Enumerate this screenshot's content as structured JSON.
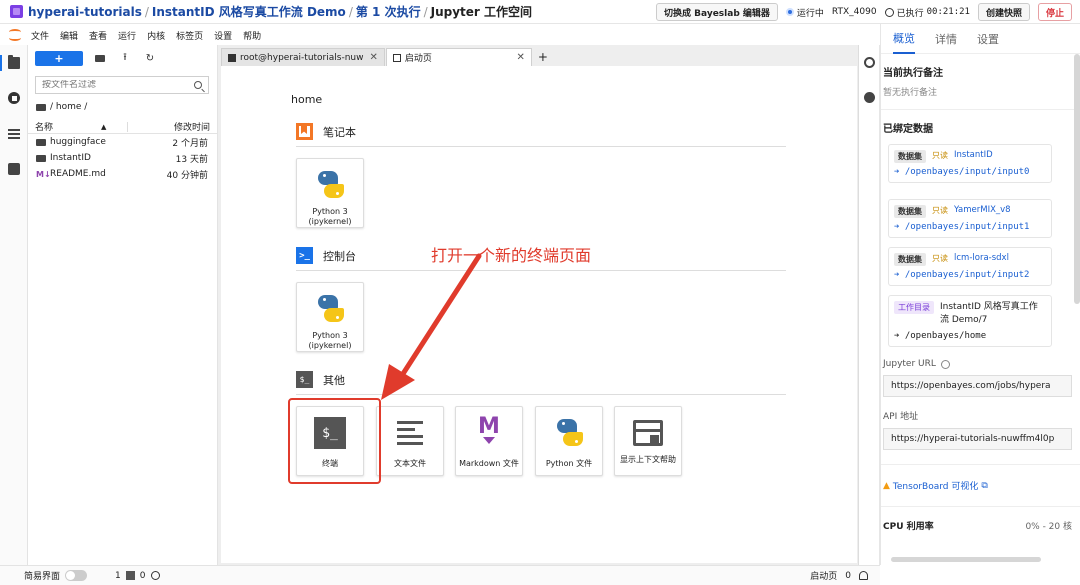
{
  "topbar": {
    "breadcrumb": [
      "hyperai-tutorials",
      "InstantID 风格写真工作流 Demo",
      "第 1 次执行",
      "Jupyter 工作空间"
    ],
    "switch_button": "切换成 Bayeslab 编辑器",
    "status": "运行中",
    "gpu": "RTX_4090",
    "elapsed_prefix": "已执行",
    "elapsed": "00:21:21",
    "snapshot_button": "创建快照",
    "stop_button": "停止",
    "colors": {
      "stop": "#d9363e",
      "running": "#2f6fe0",
      "brand": "#7b3fe4"
    }
  },
  "menu": [
    "文件",
    "编辑",
    "查看",
    "运行",
    "内核",
    "标签页",
    "设置",
    "帮助"
  ],
  "activity_icons": [
    "folder-icon",
    "running-icon",
    "toc-icon",
    "extension-icon"
  ],
  "filebrowser": {
    "new_label": "+",
    "search_placeholder": "按文件名过滤",
    "path": "/ home /",
    "col_name": "名称",
    "col_time": "修改时间",
    "items": [
      {
        "name": "huggingface",
        "time": "2 个月前",
        "icon": "folder-icon"
      },
      {
        "name": "InstantID",
        "time": "13 天前",
        "icon": "folder-icon"
      },
      {
        "name": "README.md",
        "time": "40 分钟前",
        "icon": "markdown-icon"
      }
    ]
  },
  "tabs": [
    {
      "label": "root@hyperai-tutorials-nuw",
      "icon": "terminal-icon"
    },
    {
      "label": "启动页",
      "icon": "launcher-icon"
    }
  ],
  "tab_add": "+",
  "launcher": {
    "path": "home",
    "notebook_section": "笔记本",
    "console_section": "控制台",
    "other_section": "其他",
    "console_glyph": ">_",
    "other_glyph": "$_",
    "notebook_cards": [
      {
        "label": "Python 3 (ipykernel)"
      }
    ],
    "console_cards": [
      {
        "label": "Python 3 (ipykernel)"
      }
    ],
    "other_cards": [
      {
        "label": "终端",
        "glyph": "$_"
      },
      {
        "label": "文本文件"
      },
      {
        "label": "Markdown 文件",
        "glyph": "M"
      },
      {
        "label": "Python 文件"
      },
      {
        "label": "显示上下文帮助"
      }
    ]
  },
  "annotation": {
    "text": "打开一个新的终端页面",
    "color": "#e03b2c"
  },
  "right_panel": {
    "tabs": [
      "概览",
      "详情",
      "设置"
    ],
    "notes_title": "当前执行备注",
    "notes_empty": "暂无执行备注",
    "bound_title": "已绑定数据",
    "datasets": [
      {
        "badge": "数据集",
        "access": "只读",
        "name": "InstantID",
        "path": "/openbayes/input/input0"
      },
      {
        "badge": "数据集",
        "access": "只读",
        "name": "YamerMIX_v8",
        "path": "/openbayes/input/input1"
      },
      {
        "badge": "数据集",
        "access": "只读",
        "name": "lcm-lora-sdxl",
        "path": "/openbayes/input/input2"
      }
    ],
    "workdir": {
      "badge": "工作目录",
      "name": "InstantID 风格写真工作流 Demo/7",
      "path": "/openbayes/home"
    },
    "jupyter_url_label": "Jupyter URL",
    "jupyter_url": "https://openbayes.com/jobs/hypera",
    "api_label": "API 地址",
    "api_url": "https://hyperai-tutorials-nuwffm4l0p",
    "tensorboard": "TensorBoard 可视化",
    "cpu_title": "CPU 利用率",
    "cpu_value": "0% - 20 核"
  },
  "statusbar": {
    "simple_mode": "简易界面",
    "count1": "1",
    "count2": "0",
    "right_label": "启动页",
    "right_count": "0"
  }
}
